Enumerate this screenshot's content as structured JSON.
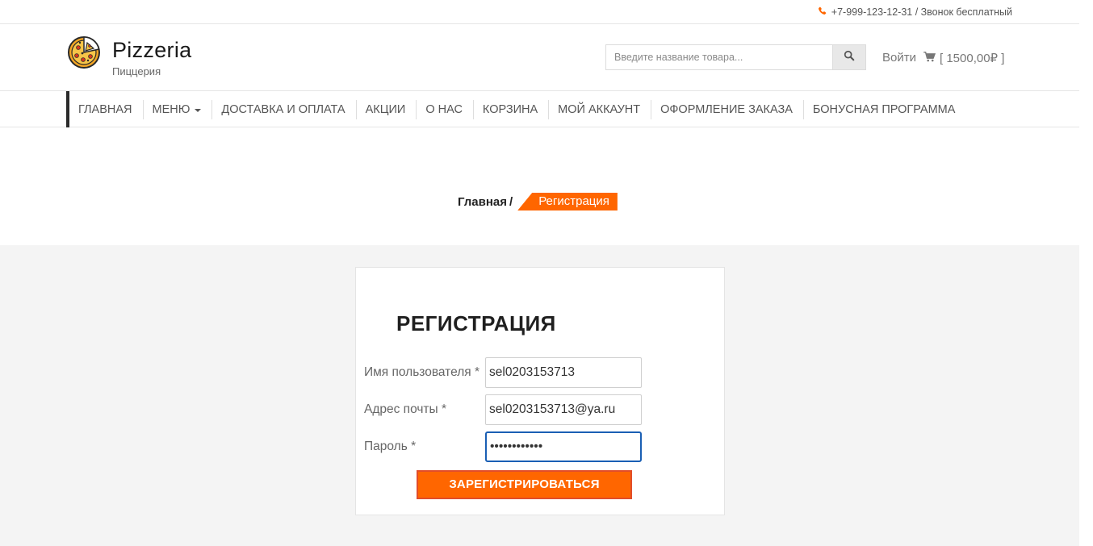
{
  "topbar": {
    "phone_icon": "phone-icon",
    "phone_text": "+7-999-123-12-31 / Звонок бесплатный"
  },
  "header": {
    "logo_icon": "pizza-icon",
    "brand": "Pizzeria",
    "tagline": "Пиццерия",
    "search": {
      "placeholder": "Введите название товара...",
      "icon": "search-icon"
    },
    "login_label": "Войти",
    "cart_icon": "cart-icon",
    "cart_text": "[ 1500,00₽ ]"
  },
  "nav": {
    "items": [
      {
        "label": "ГЛАВНАЯ"
      },
      {
        "label": "МЕНЮ"
      },
      {
        "label": "ДОСТАВКА И ОПЛАТА"
      },
      {
        "label": "АКЦИИ"
      },
      {
        "label": "О НАС"
      },
      {
        "label": "КОРЗИНА"
      },
      {
        "label": "МОЙ АККАУНТ"
      },
      {
        "label": "ОФОРМЛЕНИЕ ЗАКАЗА"
      },
      {
        "label": "БОНУСНАЯ ПРОГРАММА"
      }
    ]
  },
  "breadcrumb": {
    "home": "Главная",
    "separator": "/",
    "current": "Регистрация"
  },
  "form": {
    "title": "РЕГИСТРАЦИЯ",
    "username": {
      "label": "Имя пользователя *",
      "value": "sel0203153713"
    },
    "email": {
      "label": "Адрес почты *",
      "value": "sel0203153713@ya.ru"
    },
    "password": {
      "label": "Пароль *",
      "value": "••••••••••••"
    },
    "submit_label": "ЗАРЕГИСТРИРОВАТЬСЯ"
  },
  "colors": {
    "accent": "#ff6600",
    "nav_accent": "#2b2b2b",
    "content_bg": "#f4f4f4",
    "focus_border": "#1a5fb4"
  }
}
